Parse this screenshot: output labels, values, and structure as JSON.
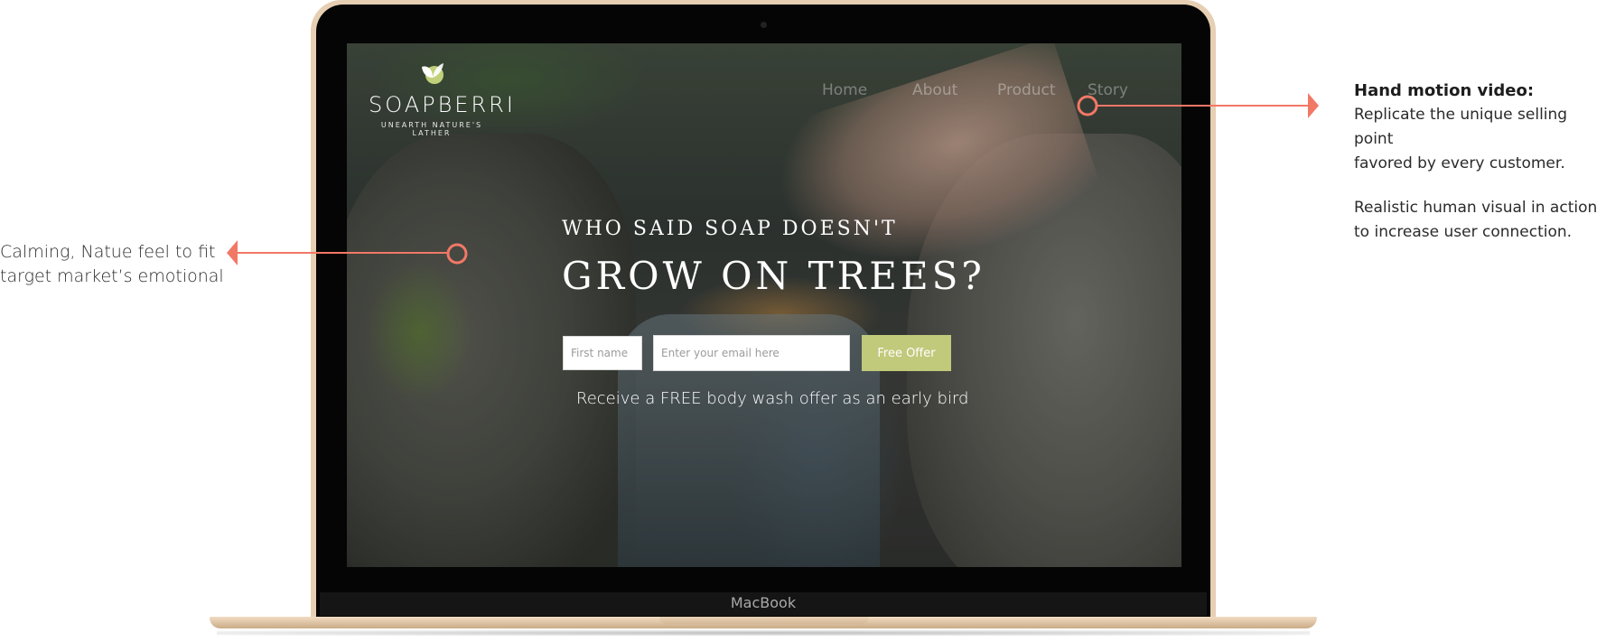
{
  "annotations": {
    "left": {
      "line1": "Calming, Natue feel to fit",
      "line2": "target market’s emotional"
    },
    "right": {
      "title": "Hand motion video:",
      "line1": "Replicate the unique selling point",
      "line2": "favored by every customer.",
      "line3": "Realistic human visual in action",
      "line4": "to increase user connection."
    },
    "accent_color": "#f27866"
  },
  "laptop": {
    "brand": "MacBook",
    "body_color": "#e6cfb3"
  },
  "site": {
    "logo": {
      "wordmark": "SOAPBERRI",
      "tagline": "UNEARTH NATURE'S LATHER",
      "icon": "leaf-logo-icon"
    },
    "nav": [
      "Home",
      "About",
      "Product",
      "Story"
    ],
    "hero": {
      "eyebrow": "WHO SAID SOAP DOESN'T",
      "headline": "GROW ON TREES?"
    },
    "form": {
      "first_name_placeholder": "First name",
      "email_placeholder": "Enter your email here",
      "button_label": "Free Offer",
      "button_color": "#c1c97b"
    },
    "subtext": "Receive a FREE body wash offer as an early bird"
  }
}
